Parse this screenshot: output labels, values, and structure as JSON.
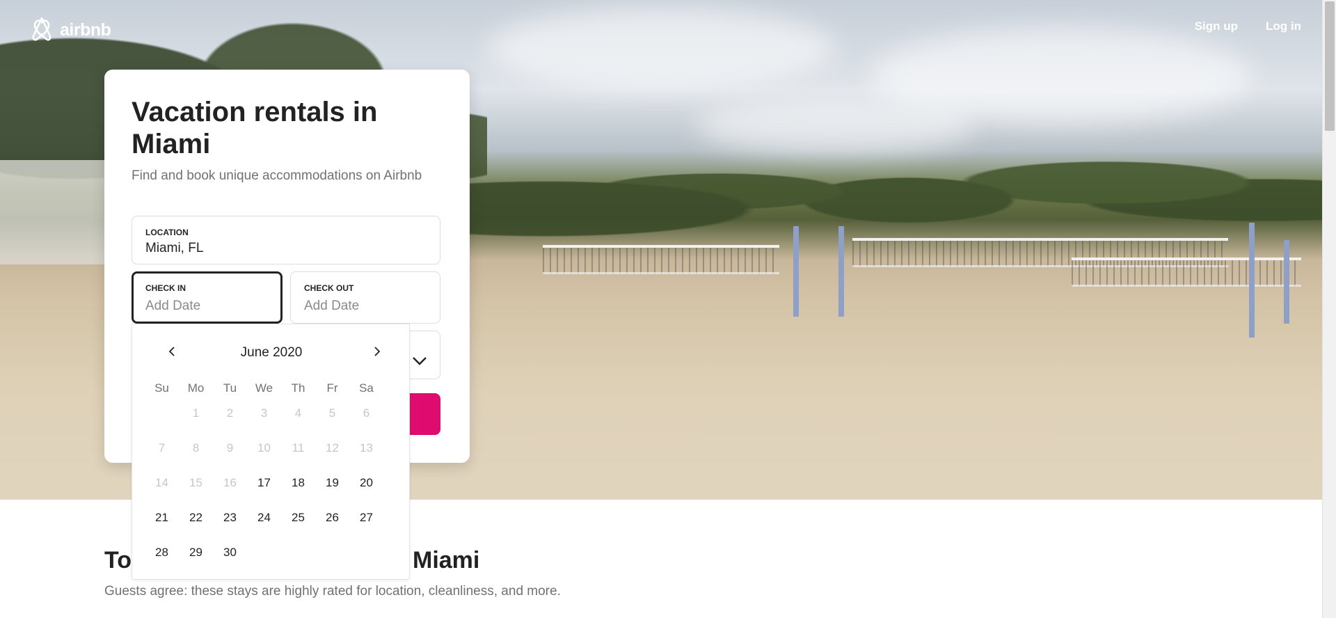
{
  "brand": {
    "name": "airbnb",
    "accent": "#E00B6E"
  },
  "nav": {
    "signup": "Sign up",
    "login": "Log in"
  },
  "search": {
    "title": "Vacation rentals in Miami",
    "subtitle": "Find and book unique accommodations on Airbnb",
    "location": {
      "label": "LOCATION",
      "value": "Miami, FL"
    },
    "checkin": {
      "label": "CHECK IN",
      "placeholder": "Add Date"
    },
    "checkout": {
      "label": "CHECK OUT",
      "placeholder": "Add Date"
    }
  },
  "calendar": {
    "month": "June 2020",
    "weekdays": [
      "Su",
      "Mo",
      "Tu",
      "We",
      "Th",
      "Fr",
      "Sa"
    ],
    "weeks": [
      [
        null,
        "1",
        "2",
        "3",
        "4",
        "5",
        "6"
      ],
      [
        "7",
        "8",
        "9",
        "10",
        "11",
        "12",
        "13"
      ],
      [
        "14",
        "15",
        "16",
        "17",
        "18",
        "19",
        "20"
      ],
      [
        "21",
        "22",
        "23",
        "24",
        "25",
        "26",
        "27"
      ],
      [
        "28",
        "29",
        "30",
        null,
        null,
        null,
        null
      ]
    ],
    "disabled_through": 16
  },
  "section": {
    "title_left": "To",
    "title_right": "Miami",
    "subtitle": "Guests agree: these stays are highly rated for location, cleanliness, and more."
  },
  "icons": {
    "logo": "airbnb-logo-icon",
    "prev": "chevron-left-icon",
    "next": "chevron-right-icon",
    "dropdown": "chevron-down-icon"
  }
}
